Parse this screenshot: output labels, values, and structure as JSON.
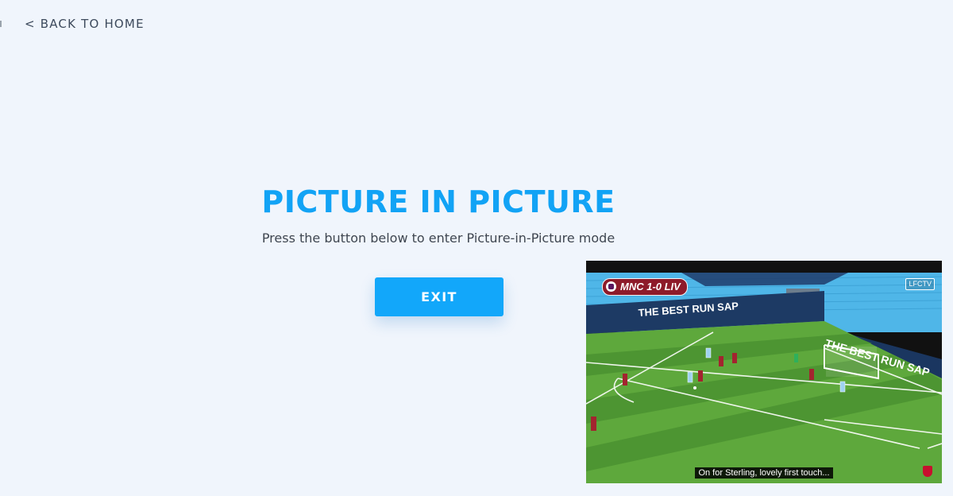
{
  "nav": {
    "back_label": "< BACK TO HOME"
  },
  "hero": {
    "title": "PICTURE IN PICTURE",
    "subtitle": "Press the button below to enter Picture-in-Picture mode",
    "button_label": "EXIT"
  },
  "pip": {
    "score_text": "MNC 1-0 LIV",
    "channel_bug": "LFCTV",
    "caption": "On for Sterling, lovely first touch...",
    "ad_board_text": "THE BEST RUN SAP",
    "ad_board_text_2": "THE BEST RUN SAP"
  },
  "colors": {
    "page_background": "#f0f5fc",
    "accent": "#12a7fa",
    "title": "#12a3f5",
    "text": "#3f4650",
    "pitch_light": "#5ea83c",
    "pitch_dark": "#4c9331",
    "stand": "#4fb6e8",
    "team_home": "#9fd2f0",
    "team_away": "#a3242f"
  }
}
